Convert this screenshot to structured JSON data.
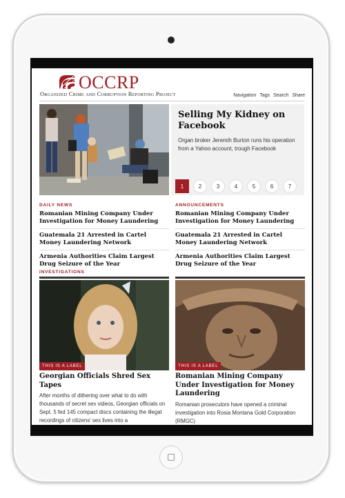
{
  "header": {
    "logo_text": "OCCRP",
    "logo_subtitle": "Organized Crime and Corruption Reporting Project",
    "nav": [
      "Navigation",
      "Tags",
      "Search",
      "Share"
    ]
  },
  "hero": {
    "title": "Selling My Kidney on Facebook",
    "description": "Organ broker Jeremih Burton runs his operation from a Yahoo account, trough Facebook",
    "pages": [
      "1",
      "2",
      "3",
      "4",
      "5",
      "6",
      "7"
    ],
    "active_page": 1
  },
  "daily_news": {
    "label": "DAILY NEWS",
    "items": [
      "Romanian Mining Company Under Investigation for Money Laundering",
      "Guatemala 21 Arrested in Cartel Money Laundering Network",
      "Armenia Authorities Claim Largest Drug Seizure of the Year"
    ]
  },
  "announcements": {
    "label": "ANNOUNCEMENTS",
    "items": [
      "Romanian Mining Company Under Investigation for Money Laundering",
      "Guatemala 21 Arrested in Cartel Money Laundering Network",
      "Armenia Authorities Claim Largest Drug Seizure of the Year"
    ]
  },
  "investigations": {
    "label": "INVESTIGATIONS",
    "cards": [
      {
        "tag": "THIS IS A LABEL",
        "title": "Georgian Officials Shred Sex Tapes",
        "body": "After months of dithering over what to do with thousands of secret sex videos, Georgian officials on Sept. 5 fed 145 compact discs containing the illegal recordings of citizens' sex lives into a"
      },
      {
        "tag": "THIS IS A LABEL",
        "title": "Romanian Mining Company Under Investigation for Money Laundering",
        "body": "Romanian prosecutors have opened a criminal investigation into Rosia Montana Gold Corporation (RMGC)"
      }
    ]
  },
  "colors": {
    "brand": "#a01f24",
    "text": "#111111"
  }
}
